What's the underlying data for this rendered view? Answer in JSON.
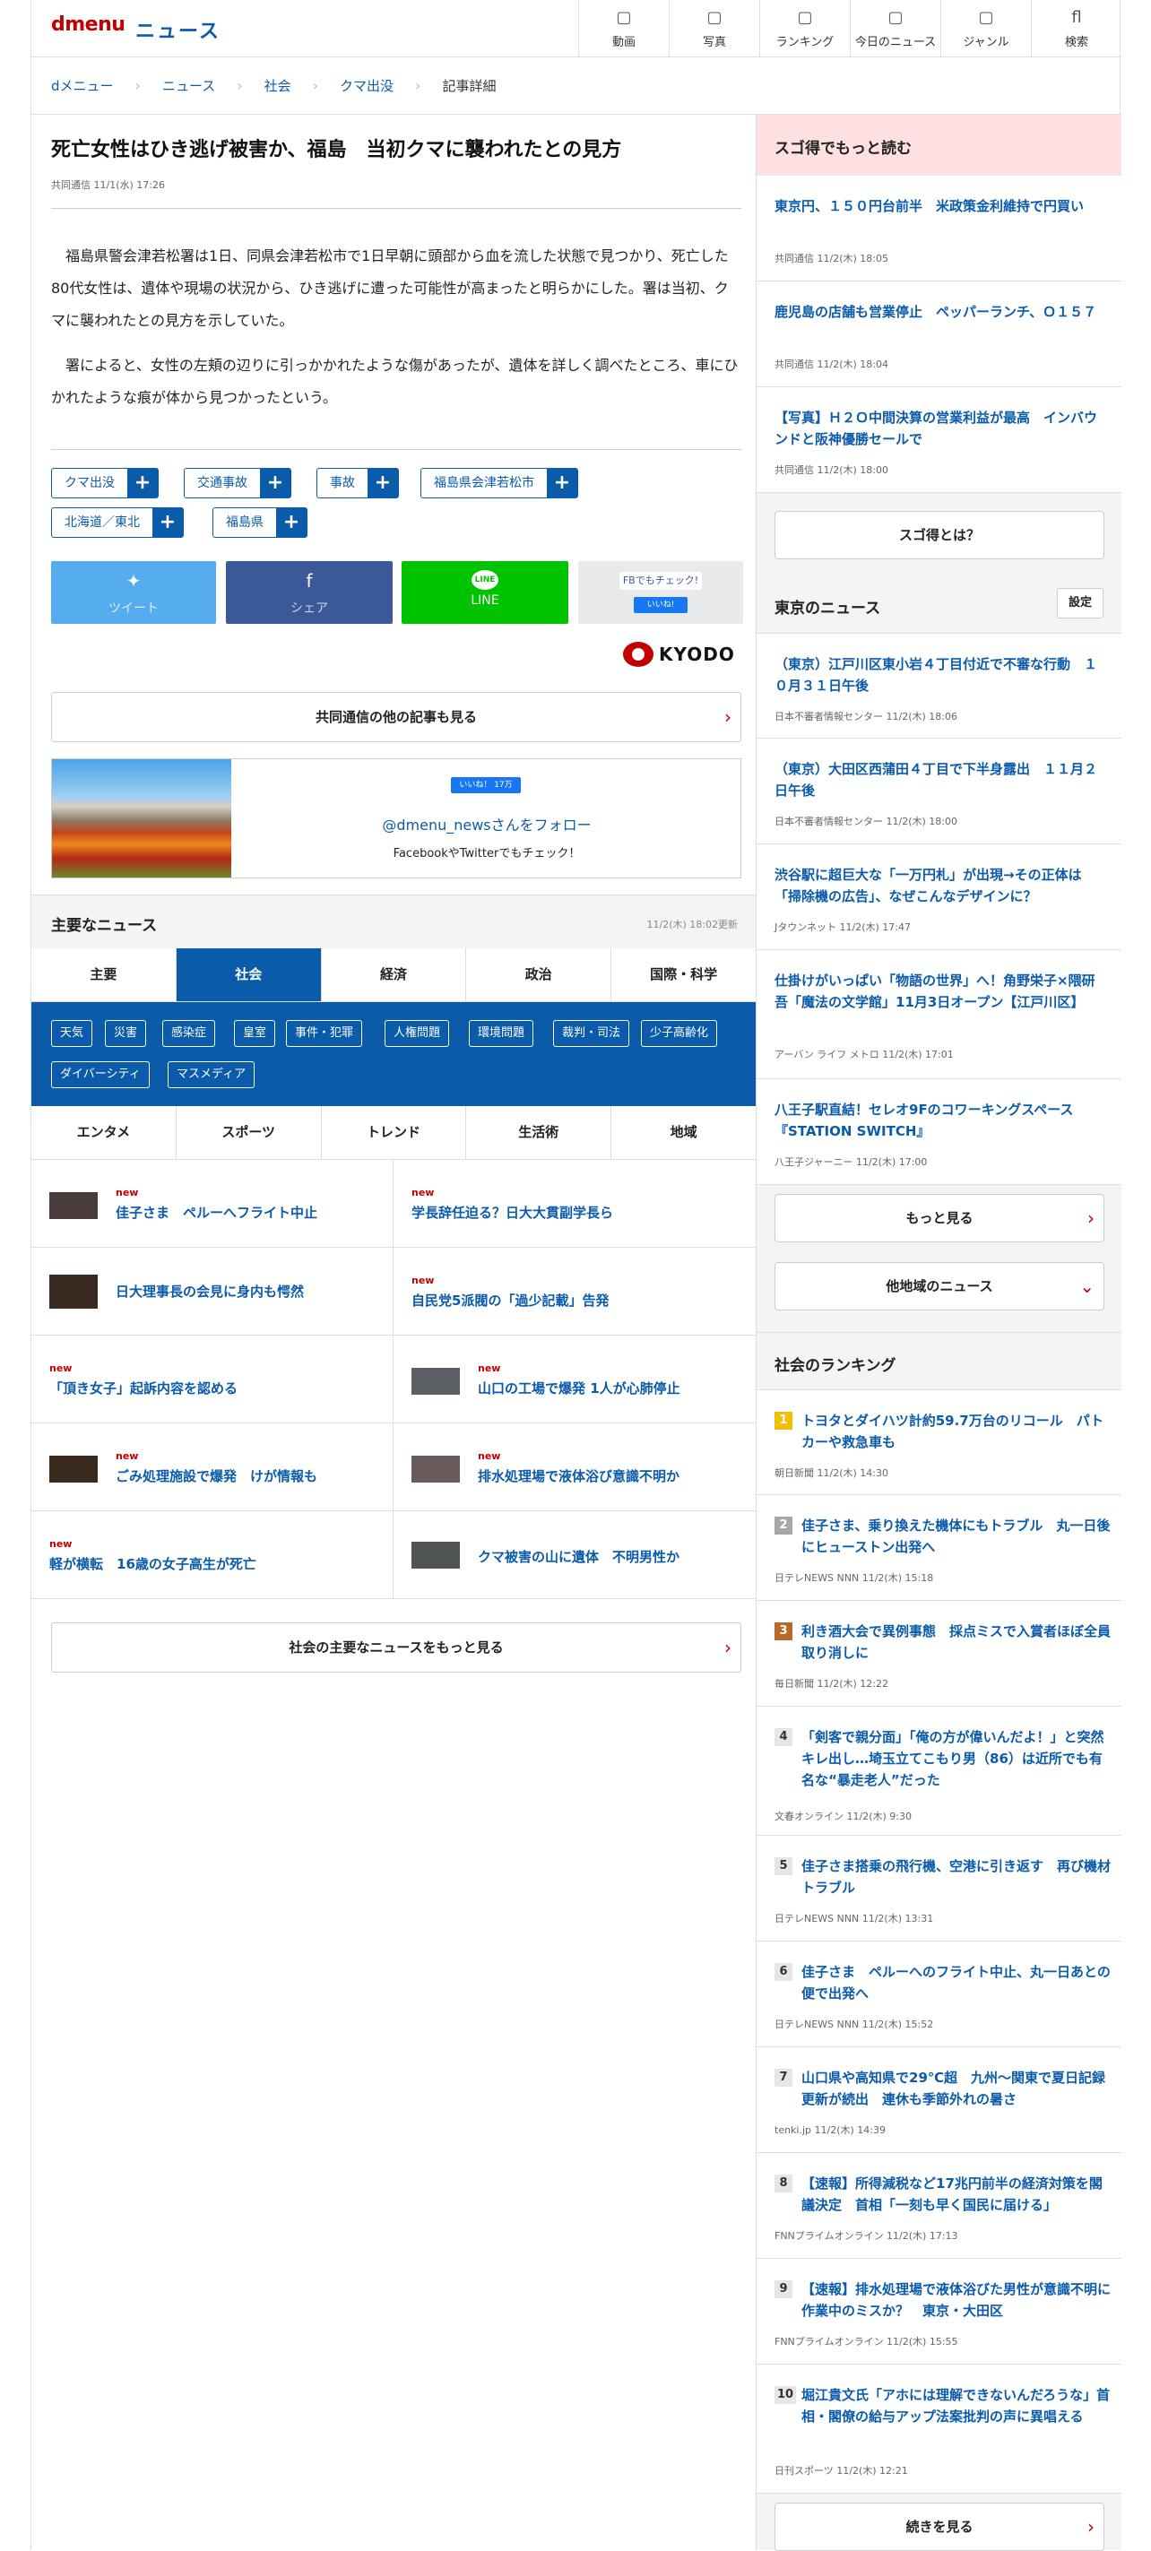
{
  "header": {
    "logo": "dmenu",
    "section": "ニュース",
    "nav": [
      {
        "icon": "video-icon",
        "glyph": "▢",
        "label": "動画"
      },
      {
        "icon": "photo-icon",
        "glyph": "▢",
        "label": "写真"
      },
      {
        "icon": "ranking-icon",
        "glyph": "▢",
        "label": "ランキング"
      },
      {
        "icon": "calendar-icon",
        "glyph": "▢",
        "label": "今日のニュース"
      },
      {
        "icon": "genre-icon",
        "glyph": "▢",
        "label": "ジャンル"
      },
      {
        "icon": "search-icon",
        "glyph": "fl",
        "label": "検索"
      }
    ]
  },
  "breadcrumb": [
    "dメニュー",
    "ニュース",
    "社会",
    "クマ出没",
    "記事詳細"
  ],
  "article": {
    "title": "死亡女性はひき逃げ被害か、福島　当初クマに襲われたとの見方",
    "meta": "共同通信 11/1(水) 17:26",
    "paragraphs": [
      "福島県警会津若松署は1日、同県会津若松市で1日早朝に頭部から血を流した状態で見つかり、死亡した80代女性は、遺体や現場の状況から、ひき逃げに遭った可能性が高まったと明らかにした。署は当初、クマに襲われたとの見方を示していた。",
      "署によると、女性の左頬の辺りに引っかかれたような傷があったが、遺体を詳しく調べたところ、車にひかれたような痕が体から見つかったという。"
    ]
  },
  "tags": [
    "クマ出没",
    "交通事故",
    "事故",
    "福島県会津若松市",
    "北海道／東北",
    "福島県"
  ],
  "share": {
    "tweet": "ツイート",
    "share": "シェア",
    "line": "LINE",
    "fb_check": "FBでもチェック!",
    "fb_like": "いいね!"
  },
  "source": {
    "name": "KYODO",
    "more": "共同通信の他の記事も見る"
  },
  "follow": {
    "like_count": "いいね！ 17万",
    "handle": "@dmenu_newsさんをフォロー",
    "sub": "FacebookやTwitterでもチェック！"
  },
  "main_news": {
    "title": "主要なニュース",
    "updated": "11/2(木) 18:02更新",
    "tabs": [
      "主要",
      "社会",
      "経済",
      "政治",
      "国際・科学"
    ],
    "active": 1,
    "subtags": [
      "天気",
      "災害",
      "感染症",
      "皇室",
      "事件・犯罪",
      "人権問題",
      "環境問題",
      "裁判・司法",
      "少子高齢化",
      "ダイバーシティ",
      "マスメディア"
    ],
    "tabs2": [
      "エンタメ",
      "スポーツ",
      "トレンド",
      "生活術",
      "地域"
    ],
    "new_label": "new",
    "items": [
      {
        "title": "佳子さま　ペルーへフライト中止",
        "new": true,
        "thumb": true
      },
      {
        "title": "学長辞任迫る？日大大貫副学長ら",
        "new": true,
        "thumb": false
      },
      {
        "title": "日大理事長の会見に身内も愕然",
        "new": false,
        "thumb": true
      },
      {
        "title": "自民党5派閥の「過少記載」告発",
        "new": true,
        "thumb": false
      },
      {
        "title": "「頂き女子」起訴内容を認める",
        "new": true,
        "thumb": false
      },
      {
        "title": "山口の工場で爆発 1人が心肺停止",
        "new": true,
        "thumb": true
      },
      {
        "title": "ごみ処理施設で爆発　けが情報も",
        "new": true,
        "thumb": true
      },
      {
        "title": "排水処理場で液体浴び意識不明か",
        "new": true,
        "thumb": true
      },
      {
        "title": "軽が横転　16歳の女子高生が死亡",
        "new": true,
        "thumb": false
      },
      {
        "title": "クマ被害の山に遺体　不明男性か",
        "new": false,
        "thumb": true
      }
    ],
    "more": "社会の主要なニュースをもっと見る"
  },
  "sidebar": {
    "sugotoku": {
      "title": "スゴ得でもっと読む",
      "items": [
        {
          "title": "東京円、１５０円台前半　米政策金利維持で円買い",
          "meta": "共同通信 11/2(木) 18:05"
        },
        {
          "title": "鹿児島の店舗も営業停止　ペッパーランチ、Ｏ１５７",
          "meta": "共同通信 11/2(木) 18:04"
        },
        {
          "title": "【写真】Ｈ２Ｏ中間決算の営業利益が最高　インバウンドと阪神優勝セールで",
          "meta": "共同通信 11/2(木) 18:00"
        }
      ],
      "about": "スゴ得とは？"
    },
    "tokyo": {
      "title": "東京のニュース",
      "setting": "設定",
      "items": [
        {
          "title": "（東京）江戸川区東小岩４丁目付近で不審な行動　１０月３１日午後",
          "meta": "日本不審者情報センター 11/2(木) 18:06"
        },
        {
          "title": "（東京）大田区西蒲田４丁目で下半身露出　１１月２日午後",
          "meta": "日本不審者情報センター 11/2(木) 18:00"
        },
        {
          "title": "渋谷駅に超巨大な「一万円札」が出現→その正体は「掃除機の広告」、なぜこんなデザインに？",
          "meta": "Jタウンネット 11/2(木) 17:47"
        },
        {
          "title": "仕掛けがいっぱい「物語の世界」へ！角野栄子×隈研吾「魔法の文学館」11月3日オープン【江戸川区】",
          "meta": "アーバン ライフ メトロ 11/2(木) 17:01"
        },
        {
          "title": "八王子駅直結！セレオ9Fのコワーキングスペース『STATION SWITCH』",
          "meta": "八王子ジャーニー 11/2(木) 17:00"
        }
      ],
      "more": "もっと見る",
      "other": "他地域のニュース"
    },
    "ranking": {
      "title": "社会のランキング",
      "items": [
        {
          "rank": "1",
          "title": "トヨタとダイハツ計約59.7万台のリコール　パトカーや救急車も",
          "meta": "朝日新聞 11/2(木) 14:30"
        },
        {
          "rank": "2",
          "title": "佳子さま、乗り換えた機体にもトラブル　丸一日後にヒューストン出発へ",
          "meta": "日テレNEWS NNN 11/2(木) 15:18"
        },
        {
          "rank": "3",
          "title": "利き酒大会で異例事態　採点ミスで入賞者ほぼ全員取り消しに",
          "meta": "毎日新聞 11/2(木) 12:22"
        },
        {
          "rank": "4",
          "title": "「剣客で親分面」「俺の方が偉いんだよ！」と突然キレ出し…埼玉立てこもり男（86）は近所でも有名な“暴走老人”だった",
          "meta": "文春オンライン 11/2(木) 9:30"
        },
        {
          "rank": "5",
          "title": "佳子さま搭乗の飛行機、空港に引き返す　再び機材トラブル",
          "meta": "日テレNEWS NNN 11/2(木) 13:31"
        },
        {
          "rank": "6",
          "title": "佳子さま　ペルーへのフライト中止、丸一日あとの便で出発へ",
          "meta": "日テレNEWS NNN 11/2(木) 15:52"
        },
        {
          "rank": "7",
          "title": "山口県や高知県で29℃超　九州〜関東で夏日記録更新が続出　連休も季節外れの暑さ",
          "meta": "tenki.jp 11/2(木) 14:39"
        },
        {
          "rank": "8",
          "title": "【速報】所得減税など17兆円前半の経済対策を閣議決定　首相「一刻も早く国民に届ける」",
          "meta": "FNNプライムオンライン 11/2(木) 17:13"
        },
        {
          "rank": "9",
          "title": "【速報】排水処理場で液体浴びた男性が意識不明に　作業中のミスか？　東京・大田区",
          "meta": "FNNプライムオンライン 11/2(木) 15:55"
        },
        {
          "rank": "10",
          "title": "堀江貴文氏「アホには理解できないんだろうな」首相・閣僚の給与アップ法案批判の声に異唱える",
          "meta": "日刊スポーツ 11/2(木) 12:21"
        }
      ],
      "more": "続きを見る"
    }
  },
  "colors": {
    "brand": "#c20000",
    "accent": "#0b5bab",
    "twitter": "#55acee",
    "facebook": "#3b5998",
    "line": "#00c300"
  }
}
